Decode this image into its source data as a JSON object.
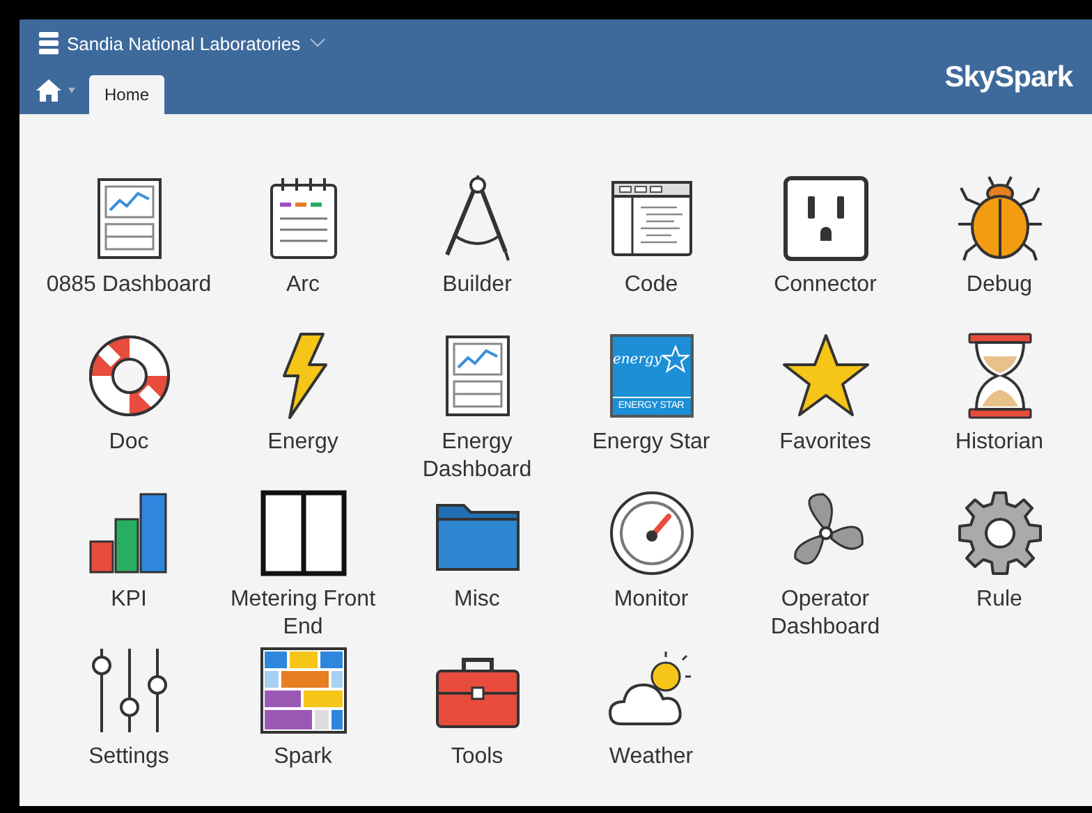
{
  "header": {
    "org": "Sandia National Laboratories",
    "brand": "SkySpark"
  },
  "tabs": [
    {
      "label": "Home",
      "selected": true
    }
  ],
  "apps": [
    {
      "label": "0885 Dashboard",
      "kind": "dashboard"
    },
    {
      "label": "Arc",
      "kind": "arc"
    },
    {
      "label": "Builder",
      "kind": "builder"
    },
    {
      "label": "Code",
      "kind": "code"
    },
    {
      "label": "Connector",
      "kind": "connector"
    },
    {
      "label": "Debug",
      "kind": "debug"
    },
    {
      "label": "Doc",
      "kind": "doc"
    },
    {
      "label": "Energy",
      "kind": "energy"
    },
    {
      "label": "Energy Dashboard",
      "kind": "dashboard"
    },
    {
      "label": "Energy Star",
      "kind": "energystar",
      "logo_script": "energy",
      "logo_caption": "ENERGY STAR"
    },
    {
      "label": "Favorites",
      "kind": "favorites"
    },
    {
      "label": "Historian",
      "kind": "historian"
    },
    {
      "label": "KPI",
      "kind": "kpi"
    },
    {
      "label": "Metering Front End",
      "kind": "metering"
    },
    {
      "label": "Misc",
      "kind": "misc"
    },
    {
      "label": "Monitor",
      "kind": "monitor"
    },
    {
      "label": "Operator Dashboard",
      "kind": "operator"
    },
    {
      "label": "Rule",
      "kind": "rule"
    },
    {
      "label": "Settings",
      "kind": "settings"
    },
    {
      "label": "Spark",
      "kind": "spark"
    },
    {
      "label": "Tools",
      "kind": "tools"
    },
    {
      "label": "Weather",
      "kind": "weather"
    }
  ]
}
